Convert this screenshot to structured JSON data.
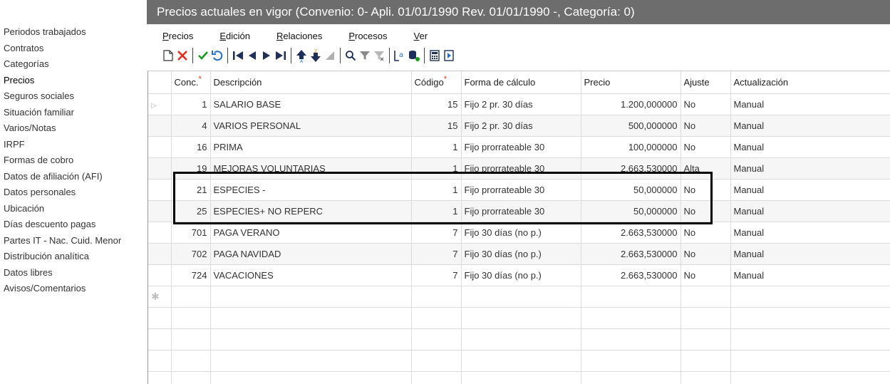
{
  "sidebar": {
    "items": [
      {
        "label": "Periodos trabajados",
        "active": false
      },
      {
        "label": "Contratos",
        "active": false
      },
      {
        "label": "Categorías",
        "active": false
      },
      {
        "label": "Precios",
        "active": true
      },
      {
        "label": "Seguros sociales",
        "active": false
      },
      {
        "label": "Situación familiar",
        "active": false
      },
      {
        "label": "Varios/Notas",
        "active": false
      },
      {
        "label": "IRPF",
        "active": false
      },
      {
        "label": "Formas de cobro",
        "active": false
      },
      {
        "label": "Datos de afiliación (AFI)",
        "active": false
      },
      {
        "label": "Datos personales",
        "active": false
      },
      {
        "label": "Ubicación",
        "active": false
      },
      {
        "label": "Días descuento pagas",
        "active": false
      },
      {
        "label": "Partes IT - Nac. Cuid. Menor",
        "active": false
      },
      {
        "label": "Distribución analítica",
        "active": false
      },
      {
        "label": "Datos libres",
        "active": false
      },
      {
        "label": "Avisos/Comentarios",
        "active": false
      }
    ]
  },
  "window": {
    "title": "Precios actuales en vigor (Convenio: 0- Apli. 01/01/1990 Rev. 01/01/1990 -, Categoría: 0)"
  },
  "menu": {
    "items": [
      {
        "first": "P",
        "rest": "recios"
      },
      {
        "first": "E",
        "rest": "dición"
      },
      {
        "first": "R",
        "rest": "elaciones"
      },
      {
        "first": "P",
        "rest": "rocesos"
      },
      {
        "first": "V",
        "rest": "er"
      }
    ]
  },
  "toolbar": {
    "icons": [
      "new-document-icon",
      "delete-icon",
      "confirm-icon",
      "undo-icon",
      "first-record-icon",
      "previous-record-icon",
      "next-record-icon",
      "last-record-icon",
      "sort-ascending-icon",
      "sort-descending-icon",
      "clear-sort-icon",
      "search-icon",
      "filter-icon",
      "clear-filter-icon",
      "label-icon",
      "database-icon",
      "calculator-icon",
      "export-icon"
    ]
  },
  "table": {
    "required_marker": "*",
    "columns": {
      "conc": "Conc.",
      "descripcion": "Descripción",
      "codigo": "Código",
      "forma": "Forma de cálculo",
      "precio": "Precio",
      "ajuste": "Ajuste",
      "actualizacion": "Actualización"
    },
    "rows": [
      {
        "conc": "1",
        "descripcion": "SALARIO BASE",
        "codigo": "15",
        "forma": "Fijo 2 pr. 30 días",
        "precio": "1.200,000000",
        "ajuste": "No",
        "actualizacion": "Manual"
      },
      {
        "conc": "4",
        "descripcion": "VARIOS PERSONAL",
        "codigo": "15",
        "forma": "Fijo 2 pr. 30 días",
        "precio": "500,000000",
        "ajuste": "No",
        "actualizacion": "Manual"
      },
      {
        "conc": "16",
        "descripcion": "PRIMA",
        "codigo": "1",
        "forma": "Fijo prorrateable 30",
        "precio": "100,000000",
        "ajuste": "No",
        "actualizacion": "Manual"
      },
      {
        "conc": "19",
        "descripcion": "MEJORAS VOLUNTARIAS",
        "codigo": "1",
        "forma": "Fijo prorrateable 30",
        "precio": "2.663,530000",
        "ajuste": "Alta",
        "actualizacion": "Manual"
      },
      {
        "conc": "21",
        "descripcion": "ESPECIES -",
        "codigo": "1",
        "forma": "Fijo prorrateable 30",
        "precio": "50,000000",
        "ajuste": "No",
        "actualizacion": "Manual"
      },
      {
        "conc": "25",
        "descripcion": "ESPECIES+ NO REPERC",
        "codigo": "1",
        "forma": "Fijo prorrateable 30",
        "precio": "50,000000",
        "ajuste": "No",
        "actualizacion": "Manual"
      },
      {
        "conc": "701",
        "descripcion": "PAGA VERANO",
        "codigo": "7",
        "forma": "Fijo 30 días (no p.)",
        "precio": "2.663,530000",
        "ajuste": "No",
        "actualizacion": "Manual"
      },
      {
        "conc": "702",
        "descripcion": "PAGA NAVIDAD",
        "codigo": "7",
        "forma": "Fijo 30 días (no p.)",
        "precio": "2.663,530000",
        "ajuste": "No",
        "actualizacion": "Manual"
      },
      {
        "conc": "724",
        "descripcion": "VACACIONES",
        "codigo": "7",
        "forma": "Fijo 30 días (no p.)",
        "precio": "2.663,530000",
        "ajuste": "No",
        "actualizacion": "Manual"
      }
    ]
  }
}
